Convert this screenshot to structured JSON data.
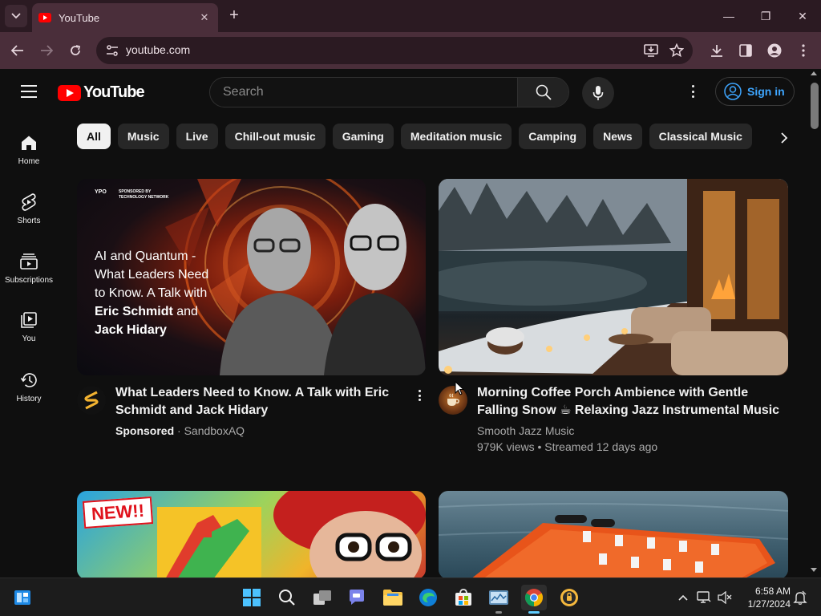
{
  "browser": {
    "tab_title": "YouTube",
    "tab_close": "✕",
    "new_tab": "+",
    "url": "youtube.com",
    "window_controls": {
      "minimize": "—",
      "maximize": "❐",
      "close": "✕"
    }
  },
  "masthead": {
    "logo_text": "YouTube",
    "search_placeholder": "Search",
    "sign_in_label": "Sign in"
  },
  "guide": {
    "items": [
      {
        "label": "Home",
        "icon": "home-icon"
      },
      {
        "label": "Shorts",
        "icon": "shorts-icon"
      },
      {
        "label": "Subscriptions",
        "icon": "subscriptions-icon"
      },
      {
        "label": "You",
        "icon": "you-icon"
      },
      {
        "label": "History",
        "icon": "history-icon"
      }
    ]
  },
  "chips": [
    "All",
    "Music",
    "Live",
    "Chill-out music",
    "Gaming",
    "Meditation music",
    "Camping",
    "News",
    "Classical Music"
  ],
  "videos": [
    {
      "title_line1": "What Leaders Need to Know. A Talk with Eric",
      "title_line2": "Schmidt and Jack Hidary",
      "sponsored": "Sponsored",
      "separator": " · ",
      "channel": "SandboxAQ",
      "thumb_text": {
        "badge_line1": "SPONSORED BY",
        "badge_line2": "TECHNOLOGY NETWORK",
        "brand": "YPO",
        "line1": "AI and Quantum -",
        "line2": "What Leaders Need",
        "line3": "to Know. A Talk with",
        "line4": "Eric Schmidt",
        "line4b": " and",
        "line5": "Jack Hidary"
      }
    },
    {
      "title_line1": "Morning Coffee Porch Ambience with Gentle",
      "title_line2": "Falling Snow ☕ Relaxing Jazz Instrumental Music",
      "channel": "Smooth Jazz Music",
      "stats": "979K views • Streamed 12 days ago"
    },
    {
      "thumb_badge": "NEW!!"
    },
    {}
  ],
  "taskbar": {
    "time": "6:58 AM",
    "date": "1/27/2024"
  },
  "colors": {
    "background": "#0f0f0f",
    "chip_bg": "#272727",
    "chip_active_bg": "#f1f1f1",
    "link_blue": "#3ea6ff",
    "youtube_red": "#ff0000",
    "browser_frame": "#4a2e3a"
  }
}
